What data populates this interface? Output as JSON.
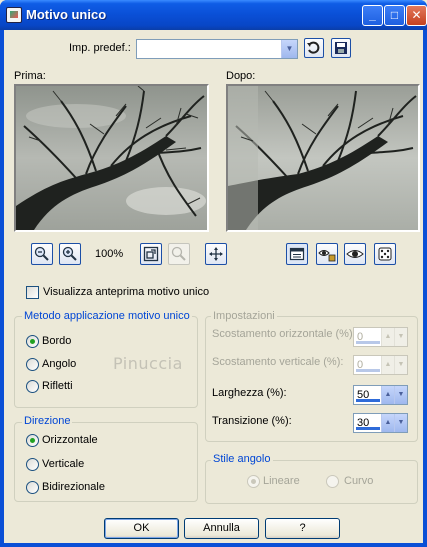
{
  "window": {
    "title": "Motivo unico"
  },
  "presets": {
    "label": "Imp. predef.:",
    "value": ""
  },
  "preview": {
    "before_label": "Prima:",
    "after_label": "Dopo:"
  },
  "zoom": {
    "level": "100%"
  },
  "show_preview": {
    "label": "Visualizza anteprima motivo unico",
    "checked": false
  },
  "method": {
    "title": "Metodo applicazione motivo unico",
    "options": [
      "Bordo",
      "Angolo",
      "Rifletti"
    ],
    "selected": "Bordo"
  },
  "watermark": "Pinuccia",
  "direction": {
    "title": "Direzione",
    "options": [
      "Orizzontale",
      "Verticale",
      "Bidirezionale"
    ],
    "selected": "Orizzontale"
  },
  "settings": {
    "title": "Impostazioni",
    "h_offset": {
      "label": "Scostamento orizzontale (%):",
      "value": "0"
    },
    "v_offset": {
      "label": "Scostamento verticale (%):",
      "value": "0"
    },
    "width": {
      "label": "Larghezza (%):",
      "value": "50"
    },
    "transition": {
      "label": "Transizione (%):",
      "value": "30"
    }
  },
  "corner_style": {
    "title": "Stile angolo",
    "options": [
      "Lineare",
      "Curvo"
    ],
    "selected": "Lineare"
  },
  "buttons": {
    "ok": "OK",
    "cancel": "Annulla",
    "help": "?"
  },
  "colors": {
    "titlebar": "#0a4fd6",
    "face": "#ece9d8",
    "group_title": "#0046d5",
    "radio_check": "#21a121"
  }
}
